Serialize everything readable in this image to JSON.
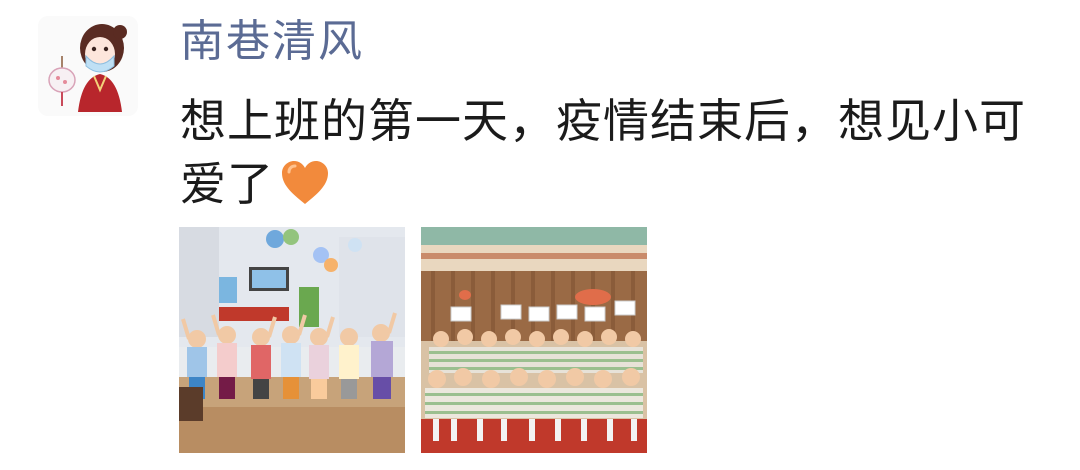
{
  "post": {
    "username": "南巷清风",
    "text": "想上班的第一天，疫情结束后，想见小可爱了",
    "emoji": "orange-heart-icon",
    "photos": [
      {
        "subject": "kindergarten-classroom-children-raising-hands"
      },
      {
        "subject": "kindergarten-group-photo-children-holding-signs"
      }
    ]
  },
  "colors": {
    "username": "#5b6b94",
    "text": "#1b1b1b",
    "heart": "#f28a3c",
    "background": "#ffffff"
  }
}
